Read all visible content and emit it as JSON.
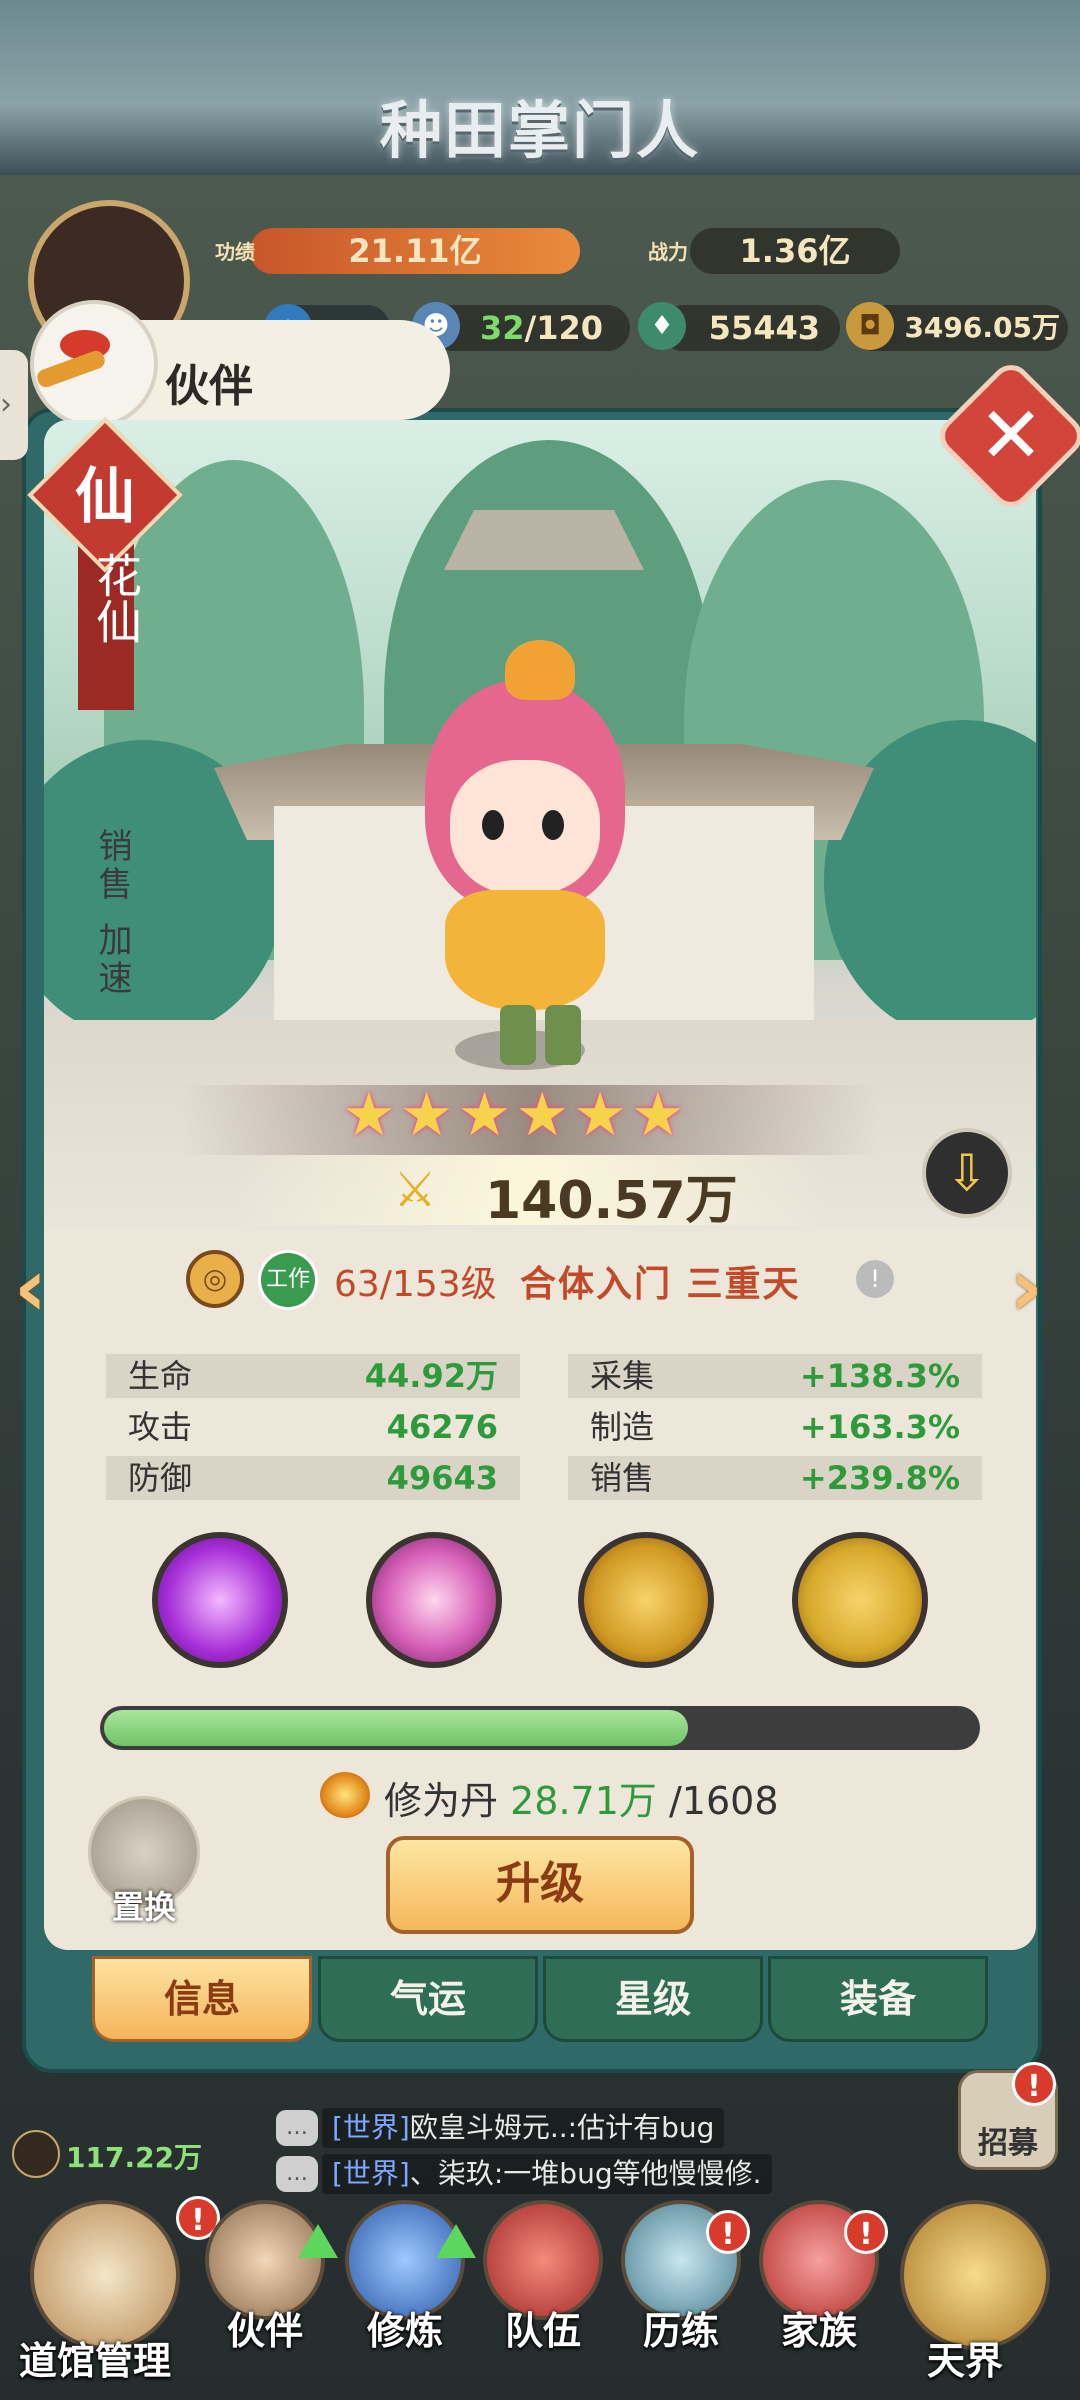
{
  "header": {
    "logo": "种田掌门人",
    "merit_label": "功绩",
    "merit_value": "21.11亿",
    "power_label": "战力",
    "power_value": "1.36亿",
    "disciples": "32",
    "disciples_max": "/120",
    "resource_a": "55443",
    "coins": "3496.05万"
  },
  "panel": {
    "title": "伙伴",
    "close_icon": "close-x-icon",
    "rank_badge": "仙",
    "name": "花仙",
    "skill_tags": [
      "销售",
      "加速"
    ],
    "stars": 6,
    "combat_power": "140.57万",
    "job_tag": "工作",
    "level_text": "63/153级",
    "realm": "合体入门 三重天",
    "stats_left": [
      {
        "label": "生命",
        "value": "44.92万"
      },
      {
        "label": "攻击",
        "value": "46276"
      },
      {
        "label": "防御",
        "value": "49643"
      }
    ],
    "stats_right": [
      {
        "label": "采集",
        "value": "+138.3%"
      },
      {
        "label": "制造",
        "value": "+163.3%"
      },
      {
        "label": "销售",
        "value": "+239.8%"
      }
    ],
    "skills": [
      "purple-feather-skill-icon",
      "cherry-blossom-skill-icon",
      "bead-necklace-icon",
      "bead-necklace-upgrade-icon"
    ],
    "progress_fraction": 0.67,
    "pill_label": "修为丹",
    "pill_have": "28.71万",
    "pill_need": "/1608",
    "swap_label": "置换",
    "upgrade_label": "升级"
  },
  "tabs": [
    {
      "label": "信息",
      "active": true
    },
    {
      "label": "气运",
      "active": false
    },
    {
      "label": "星级",
      "active": false
    },
    {
      "label": "装备",
      "active": false
    }
  ],
  "side": {
    "player_score": "117.22万",
    "recruit_label": "招募"
  },
  "chat": [
    {
      "tag": "[世界]",
      "text": "欧皇斗姆元..:估计有bug"
    },
    {
      "tag": "[世界]",
      "text": "、柒玖:一堆bug等他慢慢修."
    }
  ],
  "nav": [
    {
      "label": "道馆管理",
      "alert": true
    },
    {
      "label": "伙伴",
      "alert": false
    },
    {
      "label": "修炼",
      "alert": false
    },
    {
      "label": "队伍",
      "alert": false
    },
    {
      "label": "历练",
      "alert": true
    },
    {
      "label": "家族",
      "alert": true
    },
    {
      "label": "天界",
      "alert": false
    }
  ],
  "colors": {
    "accent_green": "#2f9a3c",
    "realm_red": "#c24a2a",
    "panel_teal": "#2f6a68"
  }
}
